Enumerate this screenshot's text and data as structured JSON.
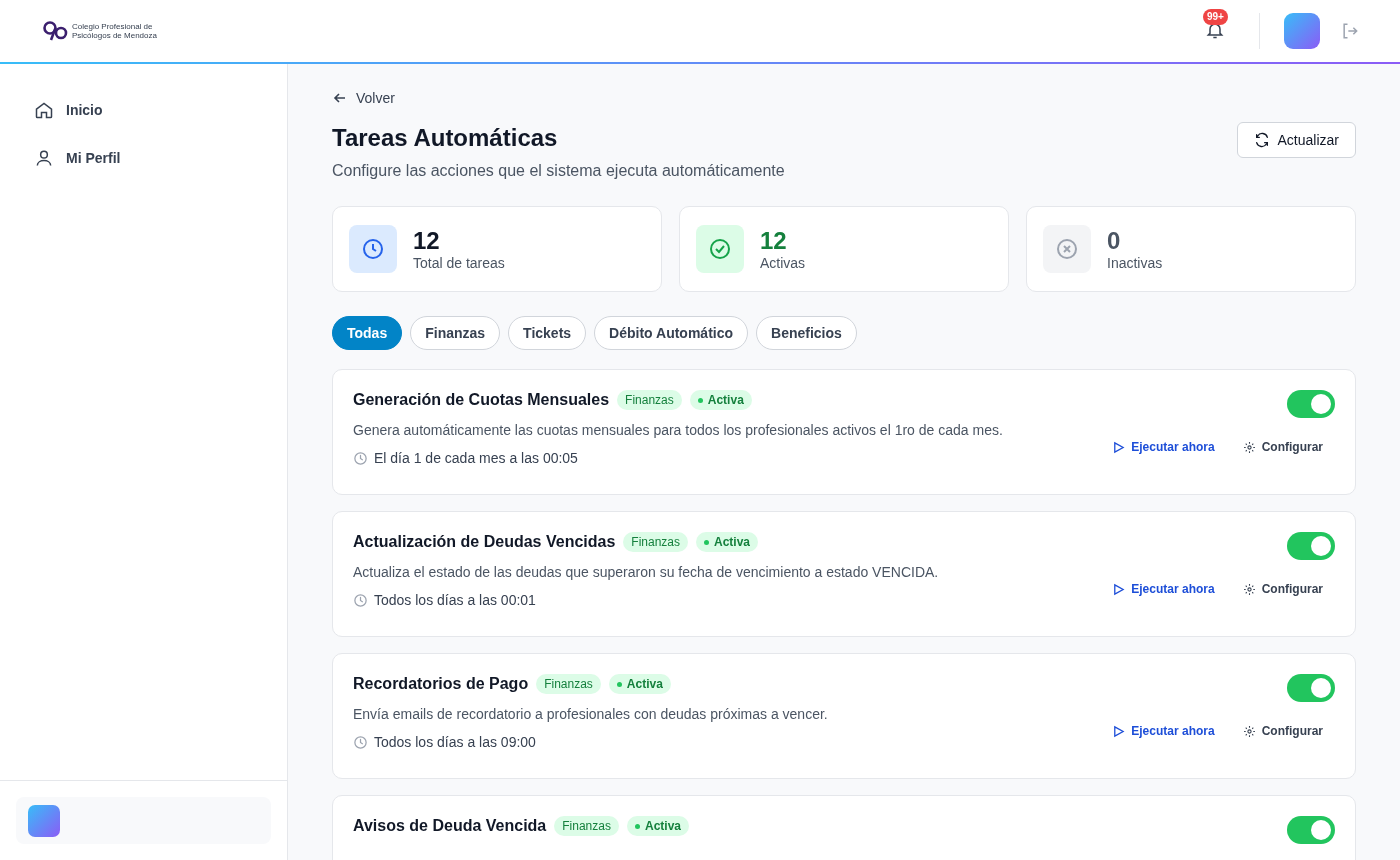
{
  "header": {
    "logo_text": [
      "Colegio Profesional de",
      "Psicólogos de Mendoza"
    ],
    "notification_badge": "99+"
  },
  "sidebar": {
    "items": [
      {
        "label": "Inicio",
        "selected": false
      },
      {
        "label": "Mi Perfil",
        "selected": false
      }
    ]
  },
  "back_link": "Volver",
  "page": {
    "title": "Tareas Automáticas",
    "subtitle": "Configure las acciones que el sistema ejecuta automáticamente",
    "refresh_button": "Actualizar"
  },
  "stats": [
    {
      "kind": "total",
      "value": "12",
      "label": "Total de tareas"
    },
    {
      "kind": "active",
      "value": "12",
      "label": "Activas"
    },
    {
      "kind": "inactive",
      "value": "0",
      "label": "Inactivas"
    }
  ],
  "filters": [
    {
      "label": "Todas",
      "selected": true
    },
    {
      "label": "Finanzas",
      "selected": false
    },
    {
      "label": "Tickets",
      "selected": false
    },
    {
      "label": "Débito Automático",
      "selected": false
    },
    {
      "label": "Beneficios",
      "selected": false
    }
  ],
  "tasks": [
    {
      "title": "Generación de Cuotas Mensuales",
      "category": "Finanzas",
      "status": "Activa",
      "active": true,
      "on": true,
      "description": "Genera automáticamente las cuotas mensuales para todos los profesionales activos el 1ro de cada mes.",
      "schedule": "El día 1 de cada mes a las 00:05",
      "run_label": "Ejecutar ahora",
      "config_label": "Configurar"
    },
    {
      "title": "Actualización de Deudas Vencidas",
      "category": "Finanzas",
      "status": "Activa",
      "active": true,
      "on": true,
      "description": "Actualiza el estado de las deudas que superaron su fecha de vencimiento a estado VENCIDA.",
      "schedule": "Todos los días a las 00:01",
      "run_label": "Ejecutar ahora",
      "config_label": "Configurar"
    },
    {
      "title": "Recordatorios de Pago",
      "category": "Finanzas",
      "status": "Activa",
      "active": true,
      "on": true,
      "description": "Envía emails de recordatorio a profesionales con deudas próximas a vencer.",
      "schedule": "Todos los días a las 09:00",
      "run_label": "Ejecutar ahora",
      "config_label": "Configurar"
    },
    {
      "title": "Avisos de Deuda Vencida",
      "category": "Finanzas",
      "status": "Activa",
      "active": true,
      "on": true
    }
  ]
}
